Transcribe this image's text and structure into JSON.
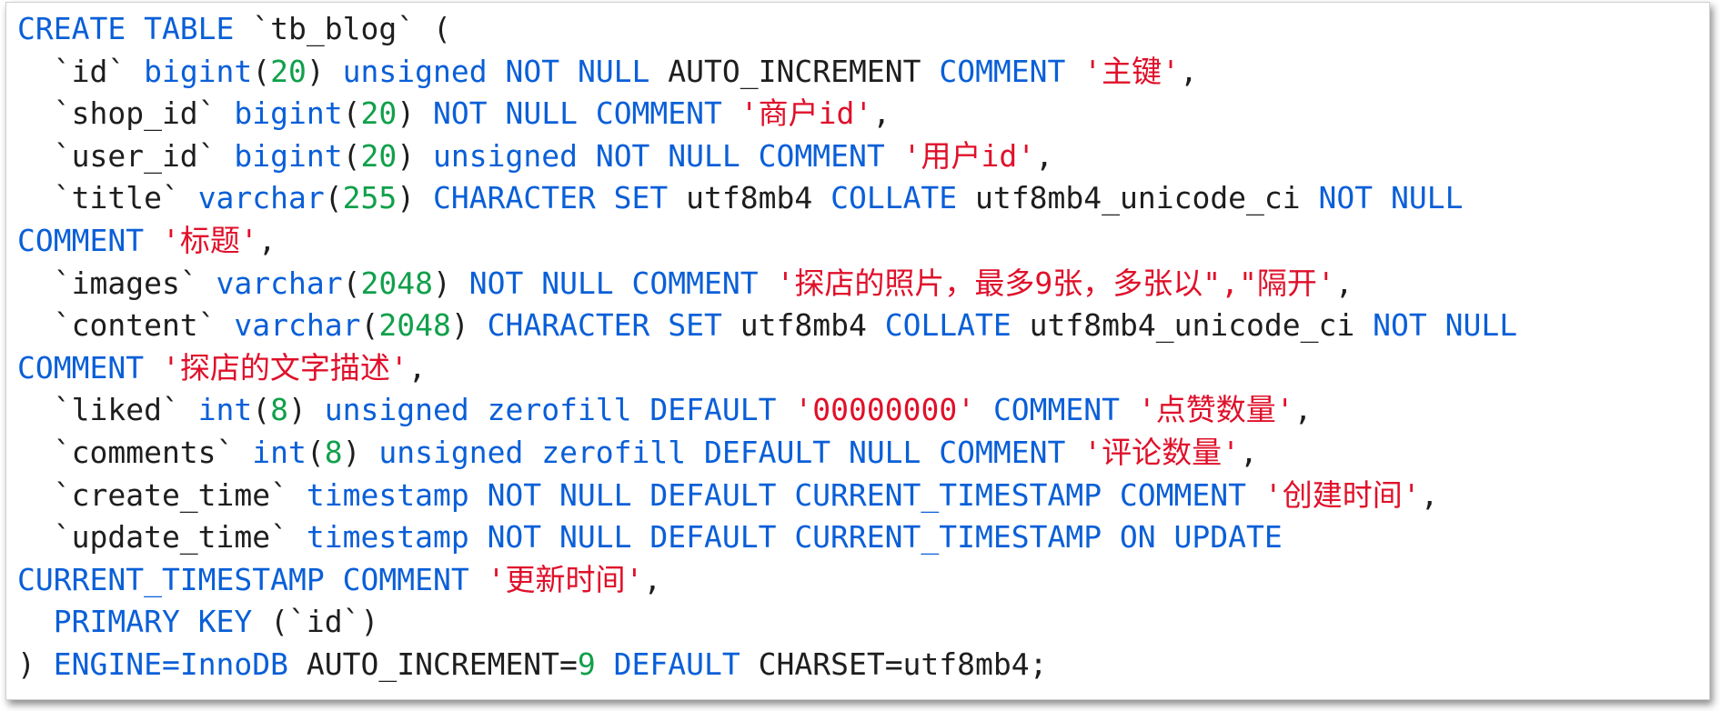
{
  "colors": {
    "keyword": "#0a5fd8",
    "number": "#10a04a",
    "string": "#e0102a",
    "text": "#1e1e1e"
  },
  "sql_lines": [
    [
      [
        "kw",
        "CREATE TABLE"
      ],
      [
        "p",
        " `tb_blog` ("
      ]
    ],
    [
      [
        "p",
        "  `id` "
      ],
      [
        "kw",
        "bigint"
      ],
      [
        "p",
        "("
      ],
      [
        "num",
        "20"
      ],
      [
        "p",
        ") "
      ],
      [
        "kw",
        "unsigned NOT NULL"
      ],
      [
        "p",
        " AUTO_INCREMENT "
      ],
      [
        "kw",
        "COMMENT"
      ],
      [
        "p",
        " "
      ],
      [
        "str",
        "'主键'"
      ],
      [
        "p",
        ","
      ]
    ],
    [
      [
        "p",
        "  `shop_id` "
      ],
      [
        "kw",
        "bigint"
      ],
      [
        "p",
        "("
      ],
      [
        "num",
        "20"
      ],
      [
        "p",
        ") "
      ],
      [
        "kw",
        "NOT NULL COMMENT"
      ],
      [
        "p",
        " "
      ],
      [
        "str",
        "'商户id'"
      ],
      [
        "p",
        ","
      ]
    ],
    [
      [
        "p",
        "  `user_id` "
      ],
      [
        "kw",
        "bigint"
      ],
      [
        "p",
        "("
      ],
      [
        "num",
        "20"
      ],
      [
        "p",
        ") "
      ],
      [
        "kw",
        "unsigned NOT NULL COMMENT"
      ],
      [
        "p",
        " "
      ],
      [
        "str",
        "'用户id'"
      ],
      [
        "p",
        ","
      ]
    ],
    [
      [
        "p",
        "  `title` "
      ],
      [
        "kw",
        "varchar"
      ],
      [
        "p",
        "("
      ],
      [
        "num",
        "255"
      ],
      [
        "p",
        ") "
      ],
      [
        "kw",
        "CHARACTER SET"
      ],
      [
        "p",
        " utf8mb4 "
      ],
      [
        "kw",
        "COLLATE"
      ],
      [
        "p",
        " utf8mb4_unicode_ci "
      ],
      [
        "kw",
        "NOT NULL"
      ]
    ],
    [
      [
        "kw",
        "COMMENT"
      ],
      [
        "p",
        " "
      ],
      [
        "str",
        "'标题'"
      ],
      [
        "p",
        ","
      ]
    ],
    [
      [
        "p",
        "  `images` "
      ],
      [
        "kw",
        "varchar"
      ],
      [
        "p",
        "("
      ],
      [
        "num",
        "2048"
      ],
      [
        "p",
        ") "
      ],
      [
        "kw",
        "NOT NULL COMMENT"
      ],
      [
        "p",
        " "
      ],
      [
        "str",
        "'探店的照片，最多9张，多张以\",\"隔开'"
      ],
      [
        "p",
        ","
      ]
    ],
    [
      [
        "p",
        "  `content` "
      ],
      [
        "kw",
        "varchar"
      ],
      [
        "p",
        "("
      ],
      [
        "num",
        "2048"
      ],
      [
        "p",
        ") "
      ],
      [
        "kw",
        "CHARACTER SET"
      ],
      [
        "p",
        " utf8mb4 "
      ],
      [
        "kw",
        "COLLATE"
      ],
      [
        "p",
        " utf8mb4_unicode_ci "
      ],
      [
        "kw",
        "NOT NULL"
      ]
    ],
    [
      [
        "kw",
        "COMMENT"
      ],
      [
        "p",
        " "
      ],
      [
        "str",
        "'探店的文字描述'"
      ],
      [
        "p",
        ","
      ]
    ],
    [
      [
        "p",
        "  `liked` "
      ],
      [
        "kw",
        "int"
      ],
      [
        "p",
        "("
      ],
      [
        "num",
        "8"
      ],
      [
        "p",
        ") "
      ],
      [
        "kw",
        "unsigned zerofill DEFAULT"
      ],
      [
        "p",
        " "
      ],
      [
        "str",
        "'00000000'"
      ],
      [
        "p",
        " "
      ],
      [
        "kw",
        "COMMENT"
      ],
      [
        "p",
        " "
      ],
      [
        "str",
        "'点赞数量'"
      ],
      [
        "p",
        ","
      ]
    ],
    [
      [
        "p",
        "  `comments` "
      ],
      [
        "kw",
        "int"
      ],
      [
        "p",
        "("
      ],
      [
        "num",
        "8"
      ],
      [
        "p",
        ") "
      ],
      [
        "kw",
        "unsigned zerofill DEFAULT NULL COMMENT"
      ],
      [
        "p",
        " "
      ],
      [
        "str",
        "'评论数量'"
      ],
      [
        "p",
        ","
      ]
    ],
    [
      [
        "p",
        "  `create_time` "
      ],
      [
        "kw",
        "timestamp NOT NULL DEFAULT CURRENT_TIMESTAMP COMMENT"
      ],
      [
        "p",
        " "
      ],
      [
        "str",
        "'创建时间'"
      ],
      [
        "p",
        ","
      ]
    ],
    [
      [
        "p",
        "  `update_time` "
      ],
      [
        "kw",
        "timestamp NOT NULL DEFAULT CURRENT_TIMESTAMP ON UPDATE"
      ]
    ],
    [
      [
        "kw",
        "CURRENT_TIMESTAMP COMMENT"
      ],
      [
        "p",
        " "
      ],
      [
        "str",
        "'更新时间'"
      ],
      [
        "p",
        ","
      ]
    ],
    [
      [
        "p",
        "  "
      ],
      [
        "kw",
        "PRIMARY KEY"
      ],
      [
        "p",
        " (`id`)"
      ]
    ],
    [
      [
        "p",
        ") "
      ],
      [
        "kw",
        "ENGINE=InnoDB"
      ],
      [
        "p",
        " AUTO_INCREMENT="
      ],
      [
        "num",
        "9"
      ],
      [
        "p",
        " "
      ],
      [
        "kw",
        "DEFAULT"
      ],
      [
        "p",
        " CHARSET=utf8mb4;"
      ]
    ]
  ]
}
